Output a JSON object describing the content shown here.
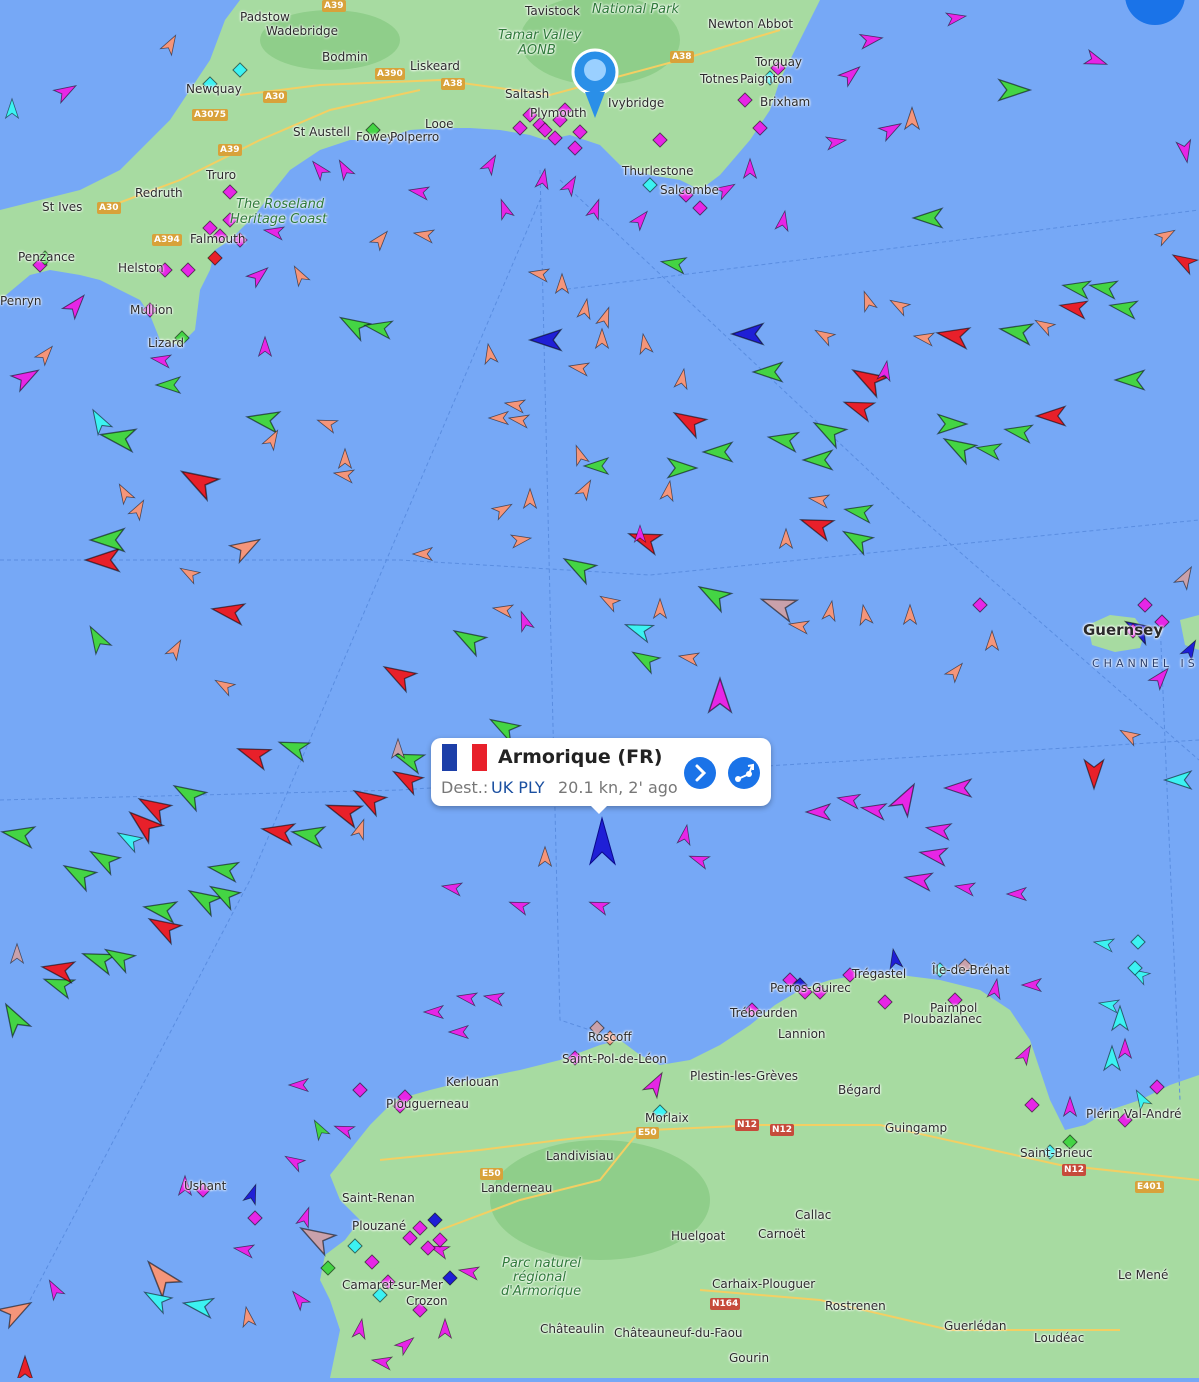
{
  "popup": {
    "vessel_name": "Armorique (FR)",
    "dest_label": "Dest.:",
    "dest_value": "UK PLY",
    "speed_info": "20.1 kn, 2' ago",
    "flag_colors": [
      "#1d3fa8",
      "#ffffff",
      "#e8212b"
    ],
    "details_icon": "chevron-right-icon",
    "route_icon": "route-icon"
  },
  "place_labels": [
    "Padstow",
    "Wadebridge",
    "Bodmin",
    "Liskeard",
    "Tavistock",
    "National Park",
    "Tamar Valley",
    "AONB",
    "Newton Abbot",
    "Torquay",
    "Totnes",
    "Paignton",
    "Brixham",
    "Saltash",
    "Plymouth",
    "Ivybridge",
    "Newquay",
    "St Austell",
    "Fowey",
    "Polperro",
    "Looe",
    "Truro",
    "Redruth",
    "St Ives",
    "Falmouth",
    "The Roseland",
    "Heritage Coast",
    "Penzance",
    "Helston",
    "Mullion",
    "Lizard",
    "Thurlestone",
    "Salcombe",
    "Penryn",
    "Guernsey",
    "CHANNEL IS",
    "Roscoff",
    "Saint-Pol-de-Léon",
    "Kerlouan",
    "Plouguerneau",
    "Morlaix",
    "Plestin-les-Grèves",
    "Perros-Guirec",
    "Trégastel",
    "Lannion",
    "Trébeurden",
    "Ploubazlanec",
    "Paimpol",
    "Bégard",
    "Guingamp",
    "Île-de-Bréhat",
    "Landivisiau",
    "Landerneau",
    "Saint-Renan",
    "Plouzané",
    "Ushant",
    "Camaret-sur-Mer",
    "Crozon",
    "Parc naturel",
    "régional",
    "d'Armorique",
    "Huelgoat",
    "Callac",
    "Carnoët",
    "Carhaix-Plouguer",
    "Rostrenen",
    "Châteaulin",
    "Châteauneuf-du-Faou",
    "Gourin",
    "Guerlédan",
    "Loudéac",
    "Le Mené",
    "Saint-Brieuc",
    "Plérin",
    "Val-André"
  ],
  "road_labels": [
    "A39",
    "A30",
    "A390",
    "A38",
    "A3075",
    "A394",
    "A30",
    "A38",
    "A39",
    "N12",
    "E50",
    "N164",
    "E401",
    "N12",
    "E50",
    "N12"
  ],
  "colors": {
    "sea": "#76a8f6",
    "land": "#a7dba1",
    "cargo": "#44d444",
    "tanker": "#e8202a",
    "passenger": "#1f1fd6",
    "pleasure": "#e626e6",
    "fishing": "#f5957a",
    "tug": "#3cf2f2",
    "unknown": "#c9a1ab"
  }
}
